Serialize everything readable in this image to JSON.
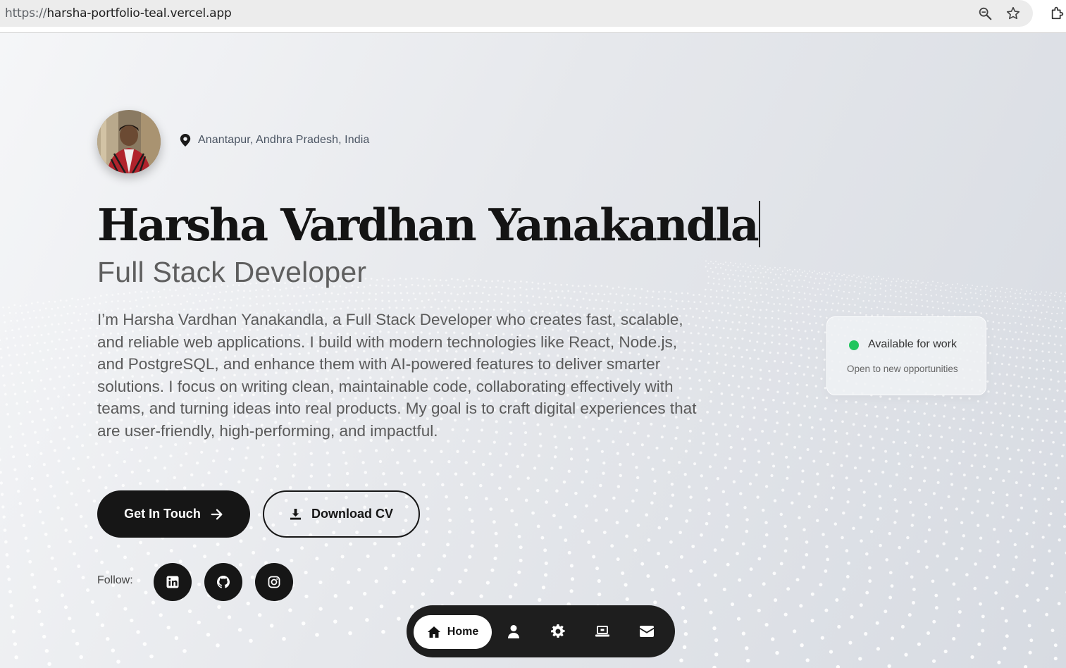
{
  "browser": {
    "url_scheme": "https://",
    "url_host": "harsha-portfolio-teal.vercel.app"
  },
  "hero": {
    "location": "Anantapur, Andhra Pradesh, India",
    "name": "Harsha Vardhan Yanakandla",
    "role": "Full Stack Developer",
    "bio": "I’m Harsha Vardhan Yanakandla, a Full Stack Developer who creates fast, scalable, and reliable web applications. I build with modern technologies like React, Node.js, and PostgreSQL, and enhance them with AI-powered features to deliver smarter solutions. I focus on writing clean, maintainable code, collaborating effectively with teams, and turning ideas into real products. My goal is to craft digital experiences that are user-friendly, high-performing, and impactful.",
    "primary_button": "Get In Touch",
    "secondary_button": "Download CV",
    "follow_label": "Follow:"
  },
  "social": [
    {
      "icon": "linkedin-icon"
    },
    {
      "icon": "github-icon"
    },
    {
      "icon": "instagram-icon"
    }
  ],
  "status": {
    "title": "Available for work",
    "subtitle": "Open to new opportunities",
    "dot_color": "#22c55e"
  },
  "nav": {
    "active_label": "Home",
    "items": [
      "home-icon",
      "user-icon",
      "gear-icon",
      "laptop-icon",
      "envelope-icon"
    ]
  },
  "colors": {
    "primary": "#161616",
    "text_muted": "#5a5a5a",
    "accent_green": "#22c55e"
  }
}
